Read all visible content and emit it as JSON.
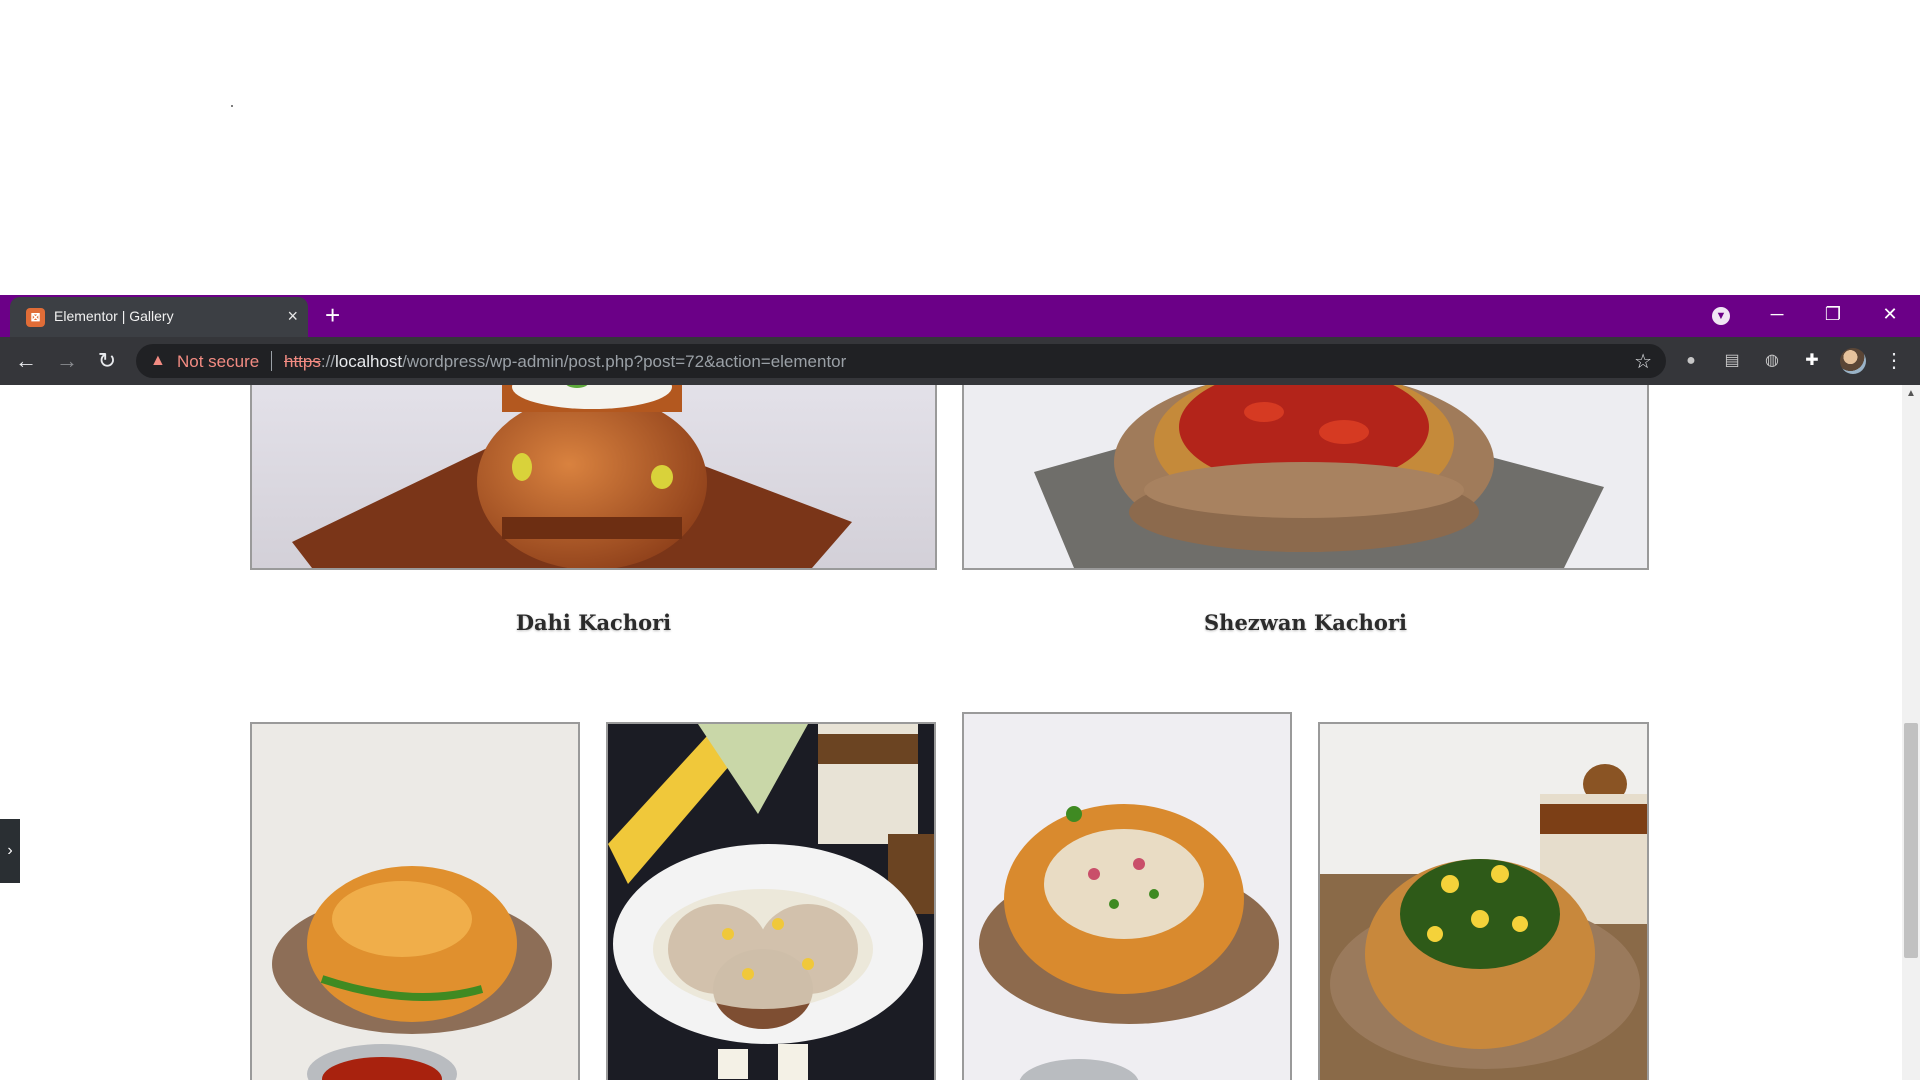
{
  "browser": {
    "tab_title": "Elementor | Gallery",
    "tab_favicon": "elementor-favicon-icon",
    "new_tab_symbol": "+",
    "security_label": "Not secure",
    "url_scheme": "https",
    "url_sep": "://",
    "url_host": "localhost",
    "url_path": "/wordpress/wp-admin/post.php?post=72&action=elementor",
    "tabbar_color": "#6b0087",
    "toolbar_color": "#35363a"
  },
  "gallery": {
    "top_row": [
      {
        "caption": "Dahi Kachori",
        "image": "dahi-kachori-photo"
      },
      {
        "caption": "Shezwan Kachori",
        "image": "shezwan-kachori-photo"
      }
    ],
    "bottom_row": [
      {
        "image": "kachori-with-chutney-photo"
      },
      {
        "image": "corn-cheese-tikki-photo"
      },
      {
        "image": "stuffed-kachori-chaat-photo"
      },
      {
        "image": "corn-chutney-kachori-photo"
      }
    ]
  }
}
